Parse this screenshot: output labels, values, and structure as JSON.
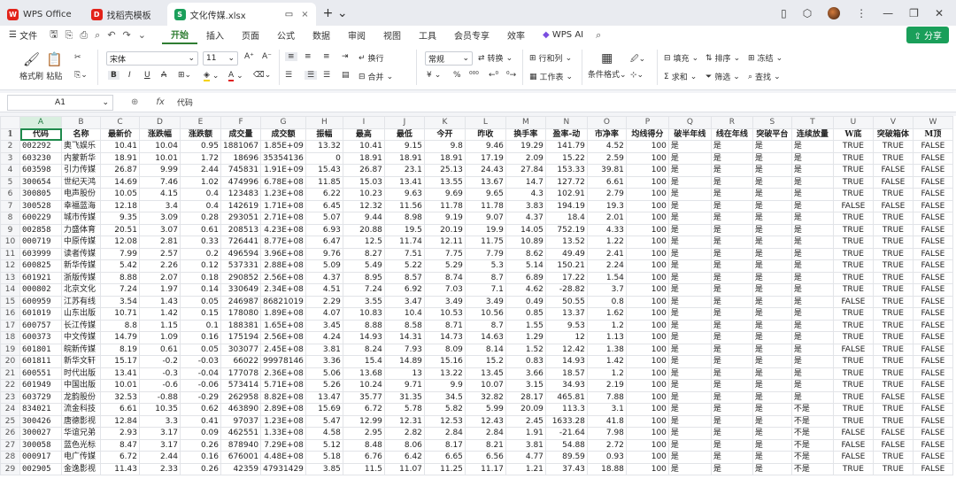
{
  "tabs": [
    {
      "label": "WPS Office",
      "logo": "W",
      "color": "#e2231a"
    },
    {
      "label": "找稻壳模板",
      "logo": "D",
      "color": "#e2231a"
    },
    {
      "label": "文化传媒.xlsx",
      "logo": "S",
      "color": "#1a9f5a"
    }
  ],
  "menu": {
    "file": "文件",
    "items": [
      "开始",
      "插入",
      "页面",
      "公式",
      "数据",
      "审阅",
      "视图",
      "工具",
      "会员专享",
      "效率"
    ],
    "wps_ai": "WPS AI",
    "share": "分享"
  },
  "ribbon": {
    "format_painter": "格式刷",
    "paste": "粘贴",
    "font": "宋体",
    "size": "11",
    "wrap": "换行",
    "merge": "合并",
    "number_format": "常规",
    "convert": "转换",
    "rows_cols": "行和列",
    "worksheet": "工作表",
    "cond_format": "条件格式",
    "fill": "填充",
    "sort": "排序",
    "freeze": "冻结",
    "sum": "求和",
    "filter": "筛选",
    "find": "查找",
    "currency": "¥",
    "percent": "%"
  },
  "formula_bar": {
    "name_box": "A1",
    "fx": "fx",
    "content": "代码"
  },
  "columns": [
    "A",
    "B",
    "C",
    "D",
    "E",
    "F",
    "G",
    "H",
    "I",
    "J",
    "K",
    "L",
    "M",
    "N",
    "O",
    "P",
    "Q",
    "R",
    "S",
    "T",
    "U",
    "V",
    "W"
  ],
  "header_row": [
    "代码",
    "名称",
    "最新价",
    "涨跌幅",
    "涨跌额",
    "成交量",
    "成交额",
    "振幅",
    "最高",
    "最低",
    "今开",
    "昨收",
    "换手率",
    "盈率-动",
    "市净率",
    "均线得分",
    "破半年线",
    "线在年线",
    "突破平台",
    "连续放量",
    "W底",
    "突破箱体",
    "M顶"
  ],
  "rows": [
    [
      "002292",
      "奥飞娱乐",
      "10.41",
      "10.04",
      "0.95",
      "1881067",
      "1.85E+09",
      "13.32",
      "10.41",
      "9.15",
      "9.8",
      "9.46",
      "19.29",
      "141.79",
      "4.52",
      "100",
      "是",
      "是",
      "是",
      "是",
      "TRUE",
      "TRUE",
      "FALSE"
    ],
    [
      "603230",
      "内蒙新华",
      "18.91",
      "10.01",
      "1.72",
      "18696",
      "35354136",
      "0",
      "18.91",
      "18.91",
      "18.91",
      "17.19",
      "2.09",
      "15.22",
      "2.59",
      "100",
      "是",
      "是",
      "是",
      "是",
      "TRUE",
      "TRUE",
      "FALSE"
    ],
    [
      "603598",
      "引力传媒",
      "26.87",
      "9.99",
      "2.44",
      "745831",
      "1.91E+09",
      "15.43",
      "26.87",
      "23.1",
      "25.13",
      "24.43",
      "27.84",
      "153.33",
      "39.81",
      "100",
      "是",
      "是",
      "是",
      "是",
      "TRUE",
      "FALSE",
      "FALSE"
    ],
    [
      "300654",
      "世纪天鸿",
      "14.69",
      "7.46",
      "1.02",
      "474996",
      "6.78E+08",
      "11.85",
      "15.03",
      "13.41",
      "13.55",
      "13.67",
      "14.7",
      "127.72",
      "6.61",
      "100",
      "是",
      "是",
      "是",
      "是",
      "TRUE",
      "FALSE",
      "FALSE"
    ],
    [
      "300805",
      "电声股份",
      "10.05",
      "4.15",
      "0.4",
      "123483",
      "1.23E+08",
      "6.22",
      "10.23",
      "9.63",
      "9.69",
      "9.65",
      "4.3",
      "102.91",
      "2.79",
      "100",
      "是",
      "是",
      "是",
      "是",
      "TRUE",
      "TRUE",
      "FALSE"
    ],
    [
      "300528",
      "幸福蓝海",
      "12.18",
      "3.4",
      "0.4",
      "142619",
      "1.71E+08",
      "6.45",
      "12.32",
      "11.56",
      "11.78",
      "11.78",
      "3.83",
      "194.19",
      "19.3",
      "100",
      "是",
      "是",
      "是",
      "是",
      "FALSE",
      "FALSE",
      "FALSE"
    ],
    [
      "600229",
      "城市传媒",
      "9.35",
      "3.09",
      "0.28",
      "293051",
      "2.71E+08",
      "5.07",
      "9.44",
      "8.98",
      "9.19",
      "9.07",
      "4.37",
      "18.4",
      "2.01",
      "100",
      "是",
      "是",
      "是",
      "是",
      "TRUE",
      "TRUE",
      "FALSE"
    ],
    [
      "002858",
      "力盛体育",
      "20.51",
      "3.07",
      "0.61",
      "208513",
      "4.23E+08",
      "6.93",
      "20.88",
      "19.5",
      "20.19",
      "19.9",
      "14.05",
      "752.19",
      "4.33",
      "100",
      "是",
      "是",
      "是",
      "是",
      "TRUE",
      "TRUE",
      "FALSE"
    ],
    [
      "000719",
      "中原传媒",
      "12.08",
      "2.81",
      "0.33",
      "726441",
      "8.77E+08",
      "6.47",
      "12.5",
      "11.74",
      "12.11",
      "11.75",
      "10.89",
      "13.52",
      "1.22",
      "100",
      "是",
      "是",
      "是",
      "是",
      "TRUE",
      "TRUE",
      "FALSE"
    ],
    [
      "603999",
      "读者传媒",
      "7.99",
      "2.57",
      "0.2",
      "496594",
      "3.96E+08",
      "9.76",
      "8.27",
      "7.51",
      "7.75",
      "7.79",
      "8.62",
      "49.49",
      "2.41",
      "100",
      "是",
      "是",
      "是",
      "是",
      "TRUE",
      "TRUE",
      "FALSE"
    ],
    [
      "600825",
      "新华传媒",
      "5.42",
      "2.26",
      "0.12",
      "537331",
      "2.88E+08",
      "5.09",
      "5.49",
      "5.22",
      "5.29",
      "5.3",
      "5.14",
      "150.21",
      "2.24",
      "100",
      "是",
      "是",
      "是",
      "是",
      "TRUE",
      "TRUE",
      "FALSE"
    ],
    [
      "601921",
      "浙版传媒",
      "8.88",
      "2.07",
      "0.18",
      "290852",
      "2.56E+08",
      "4.37",
      "8.95",
      "8.57",
      "8.74",
      "8.7",
      "6.89",
      "17.22",
      "1.54",
      "100",
      "是",
      "是",
      "是",
      "是",
      "TRUE",
      "TRUE",
      "FALSE"
    ],
    [
      "000802",
      "北京文化",
      "7.24",
      "1.97",
      "0.14",
      "330649",
      "2.34E+08",
      "4.51",
      "7.24",
      "6.92",
      "7.03",
      "7.1",
      "4.62",
      "-28.82",
      "3.7",
      "100",
      "是",
      "是",
      "是",
      "是",
      "TRUE",
      "TRUE",
      "FALSE"
    ],
    [
      "600959",
      "江苏有线",
      "3.54",
      "1.43",
      "0.05",
      "246987",
      "86821019",
      "2.29",
      "3.55",
      "3.47",
      "3.49",
      "3.49",
      "0.49",
      "50.55",
      "0.8",
      "100",
      "是",
      "是",
      "是",
      "是",
      "FALSE",
      "TRUE",
      "FALSE"
    ],
    [
      "601019",
      "山东出版",
      "10.71",
      "1.42",
      "0.15",
      "178080",
      "1.89E+08",
      "4.07",
      "10.83",
      "10.4",
      "10.53",
      "10.56",
      "0.85",
      "13.37",
      "1.62",
      "100",
      "是",
      "是",
      "是",
      "是",
      "TRUE",
      "TRUE",
      "FALSE"
    ],
    [
      "600757",
      "长江传媒",
      "8.8",
      "1.15",
      "0.1",
      "188381",
      "1.65E+08",
      "3.45",
      "8.88",
      "8.58",
      "8.71",
      "8.7",
      "1.55",
      "9.53",
      "1.2",
      "100",
      "是",
      "是",
      "是",
      "是",
      "TRUE",
      "TRUE",
      "FALSE"
    ],
    [
      "600373",
      "中文传媒",
      "14.79",
      "1.09",
      "0.16",
      "175194",
      "2.56E+08",
      "4.24",
      "14.93",
      "14.31",
      "14.73",
      "14.63",
      "1.29",
      "12",
      "1.13",
      "100",
      "是",
      "是",
      "是",
      "是",
      "TRUE",
      "TRUE",
      "FALSE"
    ],
    [
      "601801",
      "皖新传媒",
      "8.19",
      "0.61",
      "0.05",
      "303077",
      "2.45E+08",
      "3.81",
      "8.24",
      "7.93",
      "8.09",
      "8.14",
      "1.52",
      "12.42",
      "1.38",
      "100",
      "是",
      "是",
      "是",
      "是",
      "FALSE",
      "TRUE",
      "FALSE"
    ],
    [
      "601811",
      "新华文轩",
      "15.17",
      "-0.2",
      "-0.03",
      "66022",
      "99978146",
      "3.36",
      "15.4",
      "14.89",
      "15.16",
      "15.2",
      "0.83",
      "14.93",
      "1.42",
      "100",
      "是",
      "是",
      "是",
      "是",
      "TRUE",
      "TRUE",
      "FALSE"
    ],
    [
      "600551",
      "时代出版",
      "13.41",
      "-0.3",
      "-0.04",
      "177078",
      "2.36E+08",
      "5.06",
      "13.68",
      "13",
      "13.22",
      "13.45",
      "3.66",
      "18.57",
      "1.2",
      "100",
      "是",
      "是",
      "是",
      "是",
      "TRUE",
      "TRUE",
      "FALSE"
    ],
    [
      "601949",
      "中国出版",
      "10.01",
      "-0.6",
      "-0.06",
      "573414",
      "5.71E+08",
      "5.26",
      "10.24",
      "9.71",
      "9.9",
      "10.07",
      "3.15",
      "34.93",
      "2.19",
      "100",
      "是",
      "是",
      "是",
      "是",
      "TRUE",
      "TRUE",
      "FALSE"
    ],
    [
      "603729",
      "龙韵股份",
      "32.53",
      "-0.88",
      "-0.29",
      "262958",
      "8.82E+08",
      "13.47",
      "35.77",
      "31.35",
      "34.5",
      "32.82",
      "28.17",
      "465.81",
      "7.88",
      "100",
      "是",
      "是",
      "是",
      "是",
      "TRUE",
      "FALSE",
      "FALSE"
    ],
    [
      "834021",
      "流金科技",
      "6.61",
      "10.35",
      "0.62",
      "463890",
      "2.89E+08",
      "15.69",
      "6.72",
      "5.78",
      "5.82",
      "5.99",
      "20.09",
      "113.3",
      "3.1",
      "100",
      "是",
      "是",
      "是",
      "不是",
      "TRUE",
      "TRUE",
      "FALSE"
    ],
    [
      "300426",
      "唐德影视",
      "12.84",
      "3.3",
      "0.41",
      "97037",
      "1.23E+08",
      "5.47",
      "12.99",
      "12.31",
      "12.53",
      "12.43",
      "2.45",
      "1633.28",
      "41.8",
      "100",
      "是",
      "是",
      "是",
      "不是",
      "TRUE",
      "TRUE",
      "FALSE"
    ],
    [
      "300027",
      "华谊兄弟",
      "2.93",
      "3.17",
      "0.09",
      "462551",
      "1.33E+08",
      "4.58",
      "2.95",
      "2.82",
      "2.84",
      "2.84",
      "1.91",
      "-21.64",
      "7.98",
      "100",
      "是",
      "是",
      "是",
      "不是",
      "FALSE",
      "FALSE",
      "FALSE"
    ],
    [
      "300058",
      "蓝色光标",
      "8.47",
      "3.17",
      "0.26",
      "878940",
      "7.29E+08",
      "5.12",
      "8.48",
      "8.06",
      "8.17",
      "8.21",
      "3.81",
      "54.88",
      "2.72",
      "100",
      "是",
      "是",
      "是",
      "不是",
      "FALSE",
      "FALSE",
      "FALSE"
    ],
    [
      "000917",
      "电广传媒",
      "6.72",
      "2.44",
      "0.16",
      "676001",
      "4.48E+08",
      "5.18",
      "6.76",
      "6.42",
      "6.65",
      "6.56",
      "4.77",
      "89.59",
      "0.93",
      "100",
      "是",
      "是",
      "是",
      "不是",
      "FALSE",
      "TRUE",
      "FALSE"
    ],
    [
      "002905",
      "金逸影视",
      "11.43",
      "2.33",
      "0.26",
      "42359",
      "47931429",
      "3.85",
      "11.5",
      "11.07",
      "11.25",
      "11.17",
      "1.21",
      "37.43",
      "18.88",
      "100",
      "是",
      "是",
      "是",
      "不是",
      "TRUE",
      "TRUE",
      "FALSE"
    ]
  ]
}
